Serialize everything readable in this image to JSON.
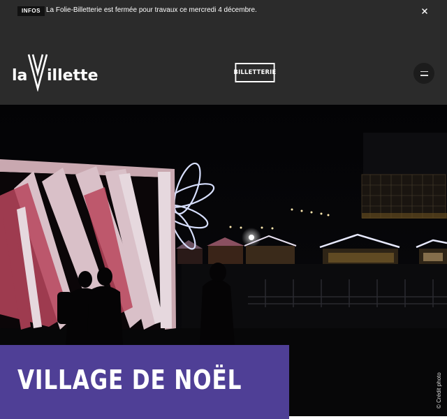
{
  "infobar": {
    "badge": "INFOS",
    "message": "La Folie-Billetterie est fermée pour travaux ce mercredi 4 décembre.",
    "close_icon": "close-icon"
  },
  "header": {
    "logo_text_left": "la",
    "logo_text_right": "illette",
    "billetterie_label": "BILLETTERIE",
    "menu_icon": "hamburger-menu-icon"
  },
  "hero": {
    "title": "VILLAGE DE NOËL",
    "credit": "© Crédit photo",
    "title_bg": "#4f3f96"
  },
  "colors": {
    "background": "#2b2b2b",
    "accent": "#4f3f96"
  }
}
